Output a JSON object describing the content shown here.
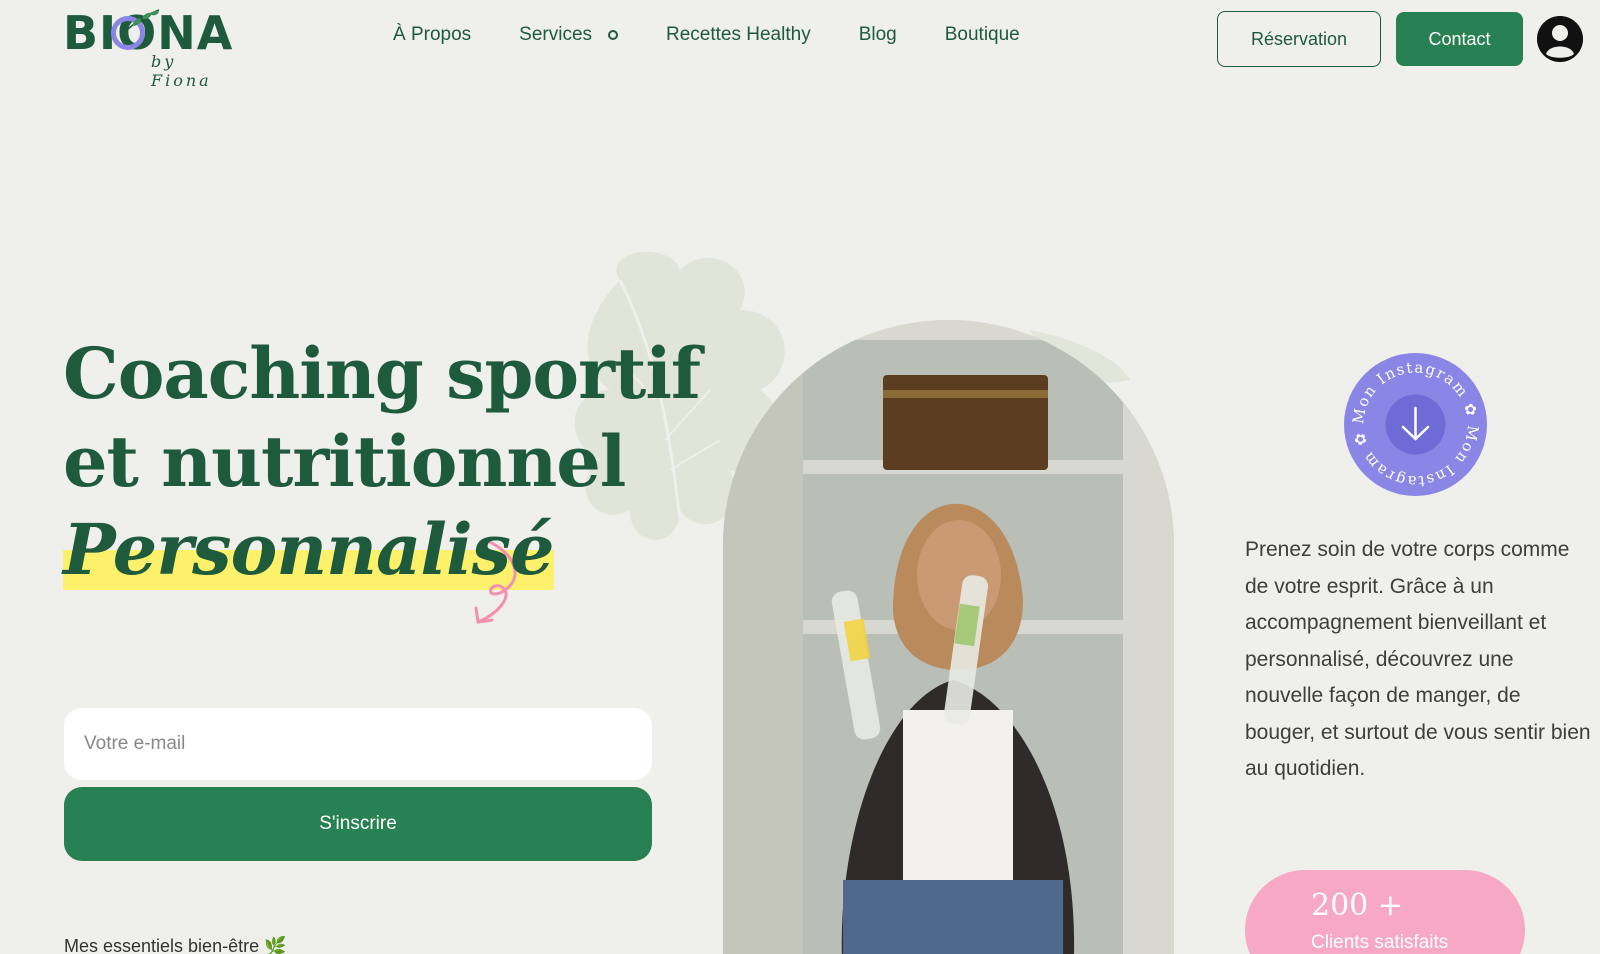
{
  "brand": {
    "logo_word": "BIONA",
    "logo_sub": "by Fiona"
  },
  "nav": {
    "items": [
      {
        "label": "À Propos"
      },
      {
        "label": "Services"
      },
      {
        "label": "Recettes Healthy"
      },
      {
        "label": "Blog"
      },
      {
        "label": "Boutique"
      }
    ]
  },
  "header": {
    "reservation_label": "Réservation",
    "contact_label": "Contact"
  },
  "hero": {
    "line1": "Coaching sportif",
    "line2": "et nutritionnel",
    "line3": "Personnalisé"
  },
  "signup": {
    "placeholder": "Votre e-mail",
    "button_label": "S'inscrire"
  },
  "essentials_text": "Mes essentiels bien-être 🌿",
  "instagram": {
    "ring_text": "Mon Instagram ✿ Mon Instagram ✿"
  },
  "intro_paragraph": "Prenez soin de votre corps comme de votre esprit. Grâce à un accompagnement bienveillant et personnalisé, découvrez une nouvelle façon de manger, de bouger, et surtout de vous sentir bien au quotidien.",
  "stat": {
    "value": "200 +",
    "label": "Clients satisfaits"
  },
  "colors": {
    "background": "#efefeb",
    "primary_green": "#288152",
    "dark_green": "#1e5a3c",
    "highlight_yellow": "#fdf06a",
    "instagram_purple": "#8a86e6",
    "stat_pink": "#f7a8c4"
  }
}
